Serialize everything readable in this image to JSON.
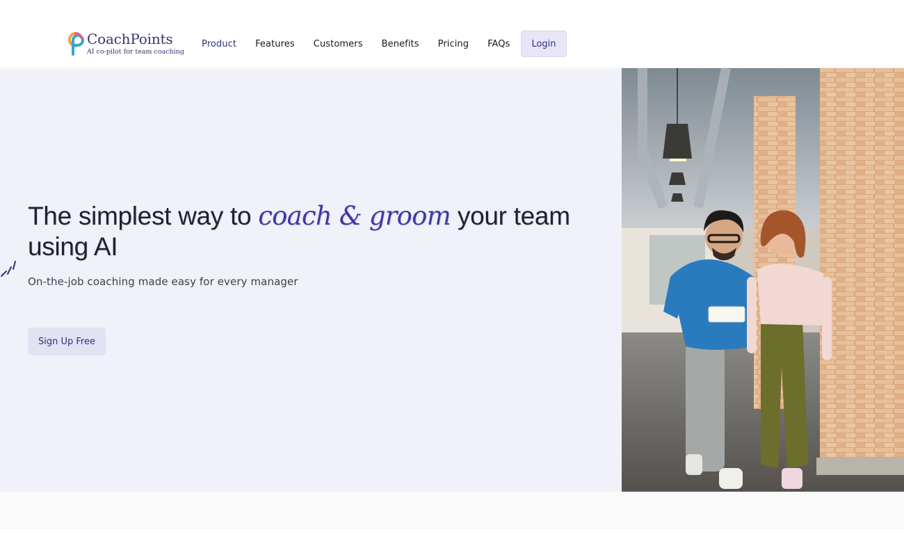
{
  "brand": {
    "name": "CoachPoints",
    "tagline": "AI co-pilot for team coaching",
    "colors": {
      "primary": "#2c3178",
      "accent_orange": "#f2a23a",
      "accent_teal": "#36a8c9",
      "hero_bg": "#f0f1f9"
    }
  },
  "nav": {
    "items": [
      {
        "label": "Product",
        "active": true
      },
      {
        "label": "Features"
      },
      {
        "label": "Customers"
      },
      {
        "label": "Benefits"
      },
      {
        "label": "Pricing"
      },
      {
        "label": "FAQs"
      }
    ],
    "login_label": "Login"
  },
  "hero": {
    "headline_prefix": "The simplest way to ",
    "headline_accent": "coach & groom",
    "headline_suffix": " your team using AI",
    "subtitle": "On-the-job coaching made easy for every manager",
    "cta_label": "Sign Up Free",
    "sparkle_icon": "sparkle-icon",
    "image_description_icon": "office-photo"
  }
}
